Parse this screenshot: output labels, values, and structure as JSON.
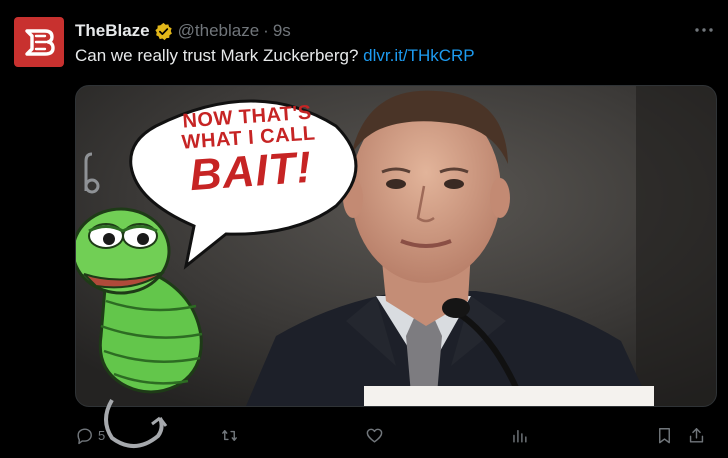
{
  "tweet": {
    "display_name": "TheBlaze",
    "handle": "@theblaze",
    "separator": "·",
    "time": "9s",
    "text": "Can we really trust Mark Zuckerberg?",
    "link": "dlvr.it/THkCRP",
    "avatar_letter": "B"
  },
  "media": {
    "speech_line1": "NOW THAT'S",
    "speech_line2": "WHAT I CALL",
    "speech_big": "BAIT!"
  },
  "actions": {
    "reply_count": "5"
  },
  "colors": {
    "background": "#000000",
    "avatar": "#c8312f",
    "link": "#1d9bf0",
    "muted": "#71767b",
    "verified": "#e2b719"
  }
}
